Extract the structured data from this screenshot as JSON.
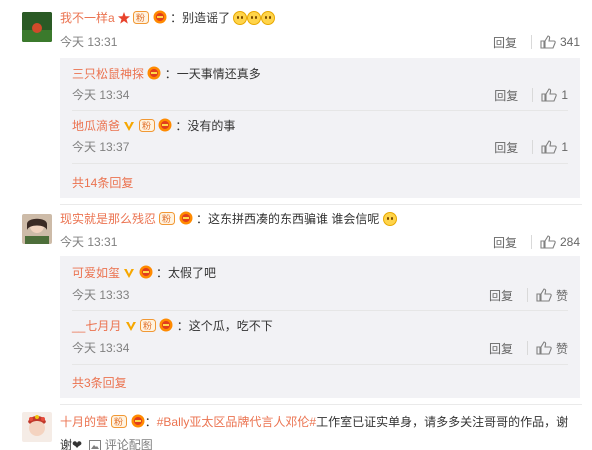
{
  "comments": [
    {
      "user": "我不一样a",
      "text": "：别造谣了",
      "time": "今天 13:31",
      "reply": "回复",
      "likes": "341",
      "replies": [
        {
          "user": "三只松鼠神探",
          "text": "：一天事情还真多",
          "time": "今天 13:34",
          "reply": "回复",
          "likes": "1"
        },
        {
          "user": "地瓜滴爸",
          "text": "：没有的事",
          "time": "今天 13:37",
          "reply": "回复",
          "likes": "1"
        }
      ],
      "more": "共14条回复"
    },
    {
      "user": "现实就是那么残忍",
      "text": "：这东拼西凑的东西骗谁 谁会信呢",
      "time": "今天 13:31",
      "reply": "回复",
      "likes": "284",
      "replies": [
        {
          "user": "可爱如玺",
          "text": "：太假了吧",
          "time": "今天 13:33",
          "reply": "回复",
          "likes": "赞"
        },
        {
          "user": "__七月月",
          "text": "：这个瓜，吃不下",
          "time": "今天 13:34",
          "reply": "回复",
          "likes": "赞"
        }
      ],
      "more": "共3条回复"
    },
    {
      "user": "十月的萱",
      "hashtag": "#Bally亚太区品牌代言人邓伦#",
      "text": "工作室已证实单身，请多多关注哥哥的作品，谢谢❤",
      "pic_label": "评论配图"
    }
  ],
  "colors": {
    "accent": "#eb7350",
    "sub_bg": "#f2f2f5",
    "meta": "#808080"
  }
}
